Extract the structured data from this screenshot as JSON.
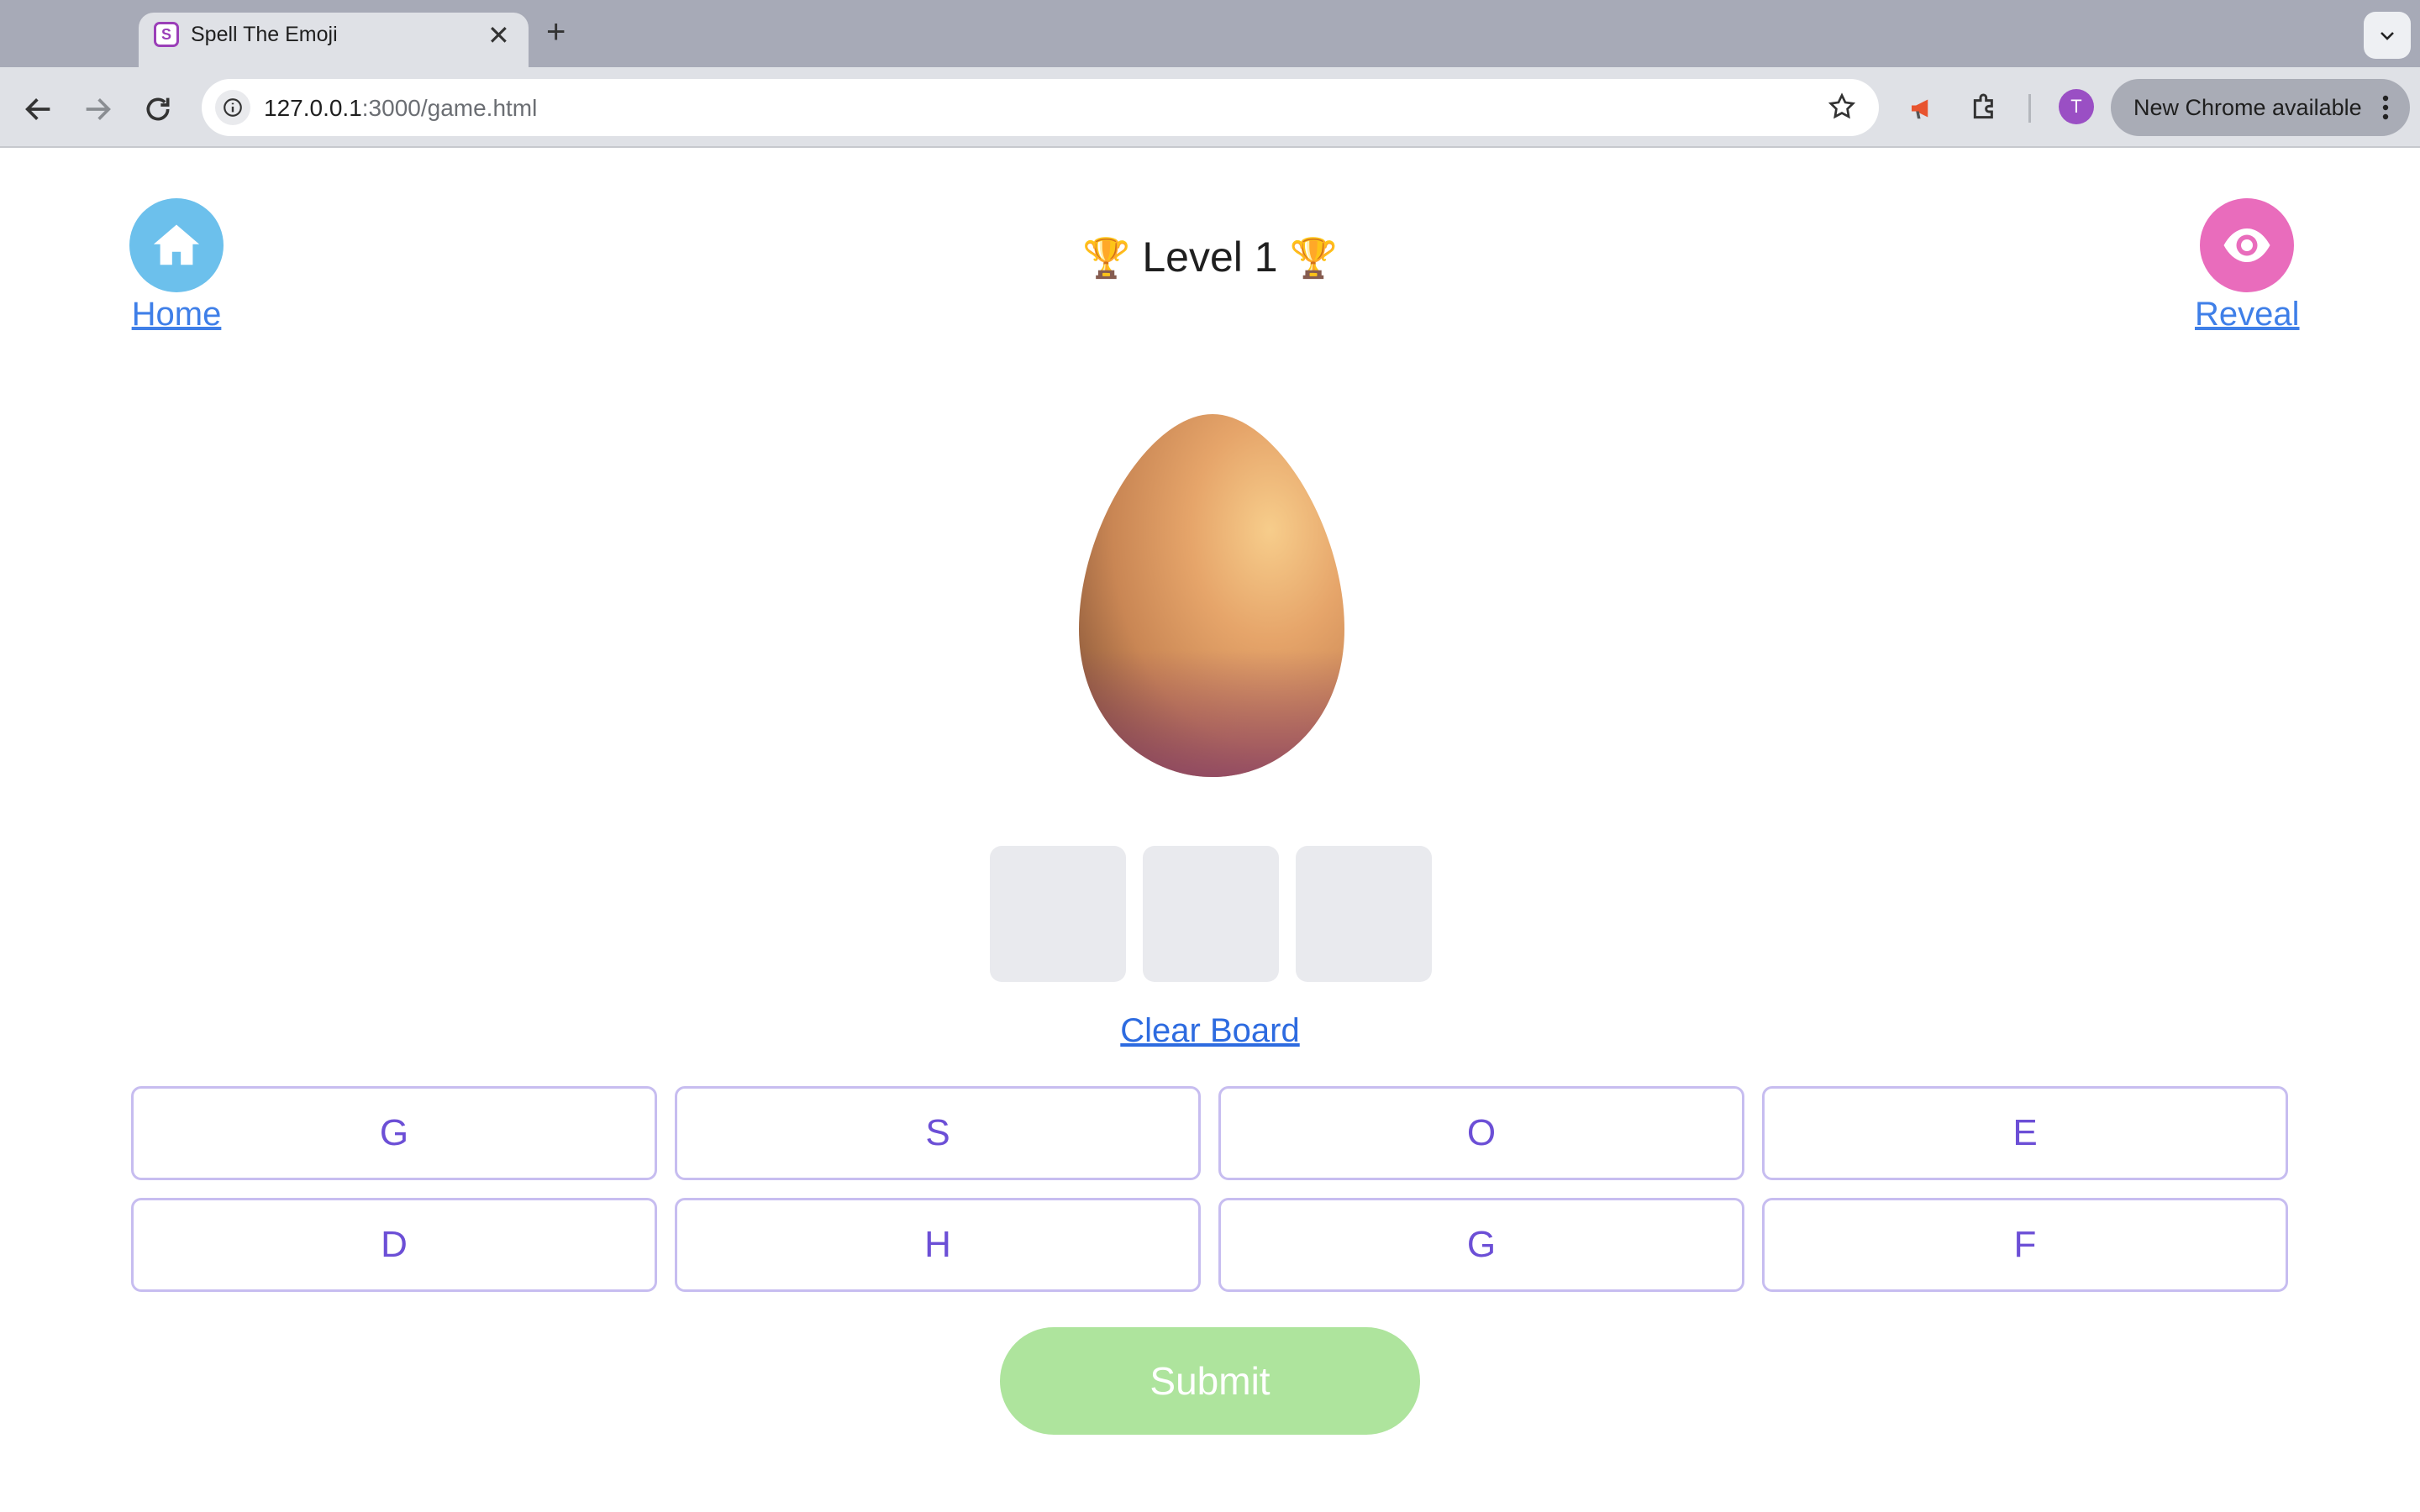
{
  "browser": {
    "tab_title": "Spell The Emoji",
    "favicon_letter": "S",
    "url_host": "127.0.0.1",
    "url_rest": ":3000/game.html",
    "profile_initial": "T",
    "update_label": "New Chrome available"
  },
  "header": {
    "home_label": "Home",
    "level_title": "Level 1",
    "trophy": "🏆",
    "reveal_label": "Reveal"
  },
  "puzzle": {
    "emoji_name": "egg-emoji",
    "slot_count": 3,
    "clear_label": "Clear Board"
  },
  "letters": [
    "G",
    "S",
    "O",
    "E",
    "D",
    "H",
    "G",
    "F"
  ],
  "submit_label": "Submit",
  "colors": {
    "home_circle": "#6cc0ec",
    "reveal_circle": "#e96cbc",
    "link": "#3f7fe8",
    "letter_border": "#c7bdf0",
    "letter_text": "#6c4fd6",
    "submit_bg": "#aee49d",
    "slot_bg": "#e9eaee"
  }
}
